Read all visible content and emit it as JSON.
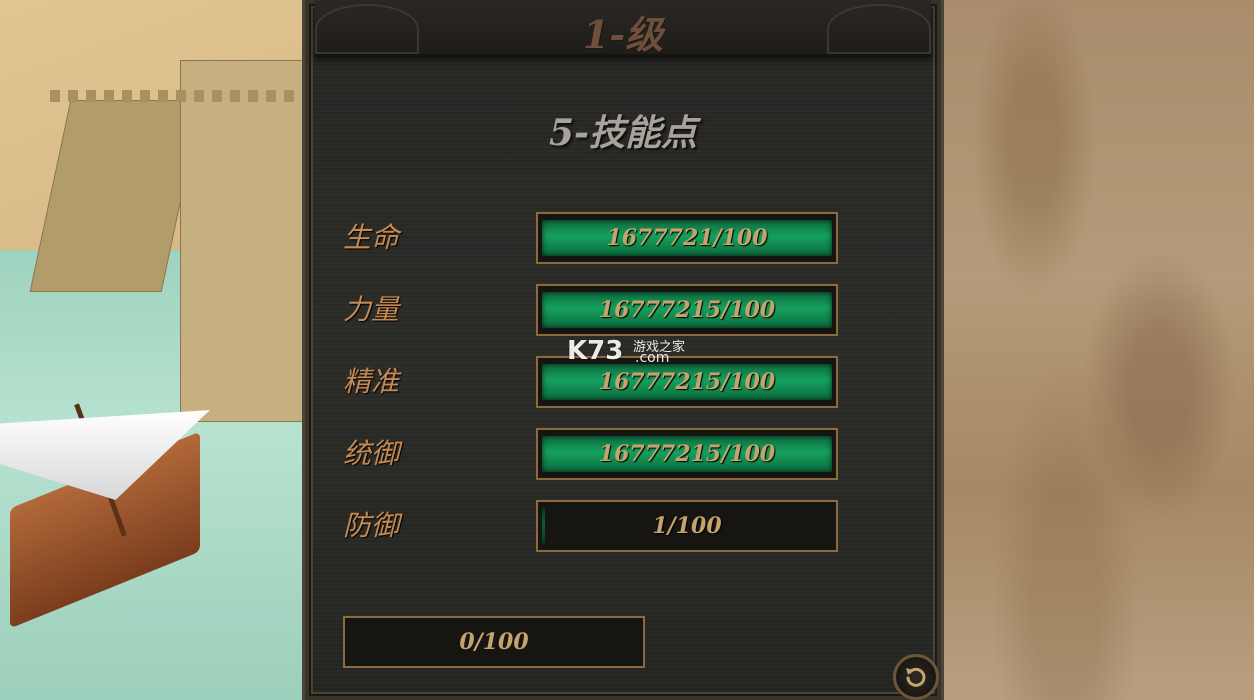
{
  "panel": {
    "level_title": "1-级",
    "skill_points": "5-技能点",
    "pool_value": "0/100"
  },
  "stats": [
    {
      "label": "生命",
      "value": "1677721/100",
      "fill_fraction": 1.0
    },
    {
      "label": "力量",
      "value": "16777215/100",
      "fill_fraction": 1.0
    },
    {
      "label": "精准",
      "value": "16777215/100",
      "fill_fraction": 1.0
    },
    {
      "label": "统御",
      "value": "16777215/100",
      "fill_fraction": 1.0
    },
    {
      "label": "防御",
      "value": "1/100",
      "fill_fraction": 0.01
    }
  ],
  "watermark": {
    "brand": "K73",
    "cn": "游戏之家",
    "domain": ".com"
  },
  "colors": {
    "bar_fill": "#14a05e",
    "label": "#c58a54",
    "value_text": "#c4a36d",
    "bar_border": "#8b6a3e"
  },
  "icons": {
    "reset": "rotate-ccw-icon"
  }
}
